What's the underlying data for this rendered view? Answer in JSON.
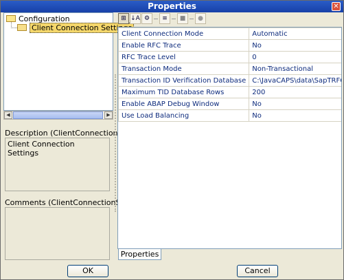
{
  "window": {
    "title": "Properties",
    "close_label": "✕"
  },
  "tree": {
    "root": "Configuration",
    "child": "Client Connection Settings"
  },
  "description": {
    "label": "Description (ClientConnectionSett...",
    "text": "Client Connection Settings"
  },
  "comments": {
    "label": "Comments (ClientConnectionSett...",
    "text": ""
  },
  "toolbar": {
    "buttons": [
      {
        "name": "categorized-view-icon",
        "glyph": "⊞"
      },
      {
        "name": "sort-alpha-icon",
        "glyph": "↓A"
      },
      {
        "name": "filter-icon",
        "glyph": "⚙"
      },
      {
        "name": "list-icon",
        "glyph": "≡"
      },
      {
        "name": "stop-icon",
        "glyph": "■"
      },
      {
        "name": "circle-icon",
        "glyph": "●"
      }
    ]
  },
  "properties": [
    {
      "name": "Client Connection Mode",
      "value": "Automatic"
    },
    {
      "name": "Enable RFC Trace",
      "value": "No"
    },
    {
      "name": "RFC Trace Level",
      "value": "0"
    },
    {
      "name": "Transaction Mode",
      "value": "Non-Transactional"
    },
    {
      "name": "Transaction ID Verification Database",
      "value": "C:\\JavaCAPS\\data\\SapTRFC.TIDd"
    },
    {
      "name": "Maximum TID Database Rows",
      "value": "200"
    },
    {
      "name": "Enable ABAP Debug Window",
      "value": "No"
    },
    {
      "name": "Use Load Balancing",
      "value": "No"
    }
  ],
  "tab": {
    "label": "Properties"
  },
  "buttons": {
    "ok": "OK",
    "cancel": "Cancel"
  },
  "colors": {
    "titlebar": "#2a5cc6",
    "selection": "#f5d76b",
    "property_text": "#0c2a7c"
  }
}
